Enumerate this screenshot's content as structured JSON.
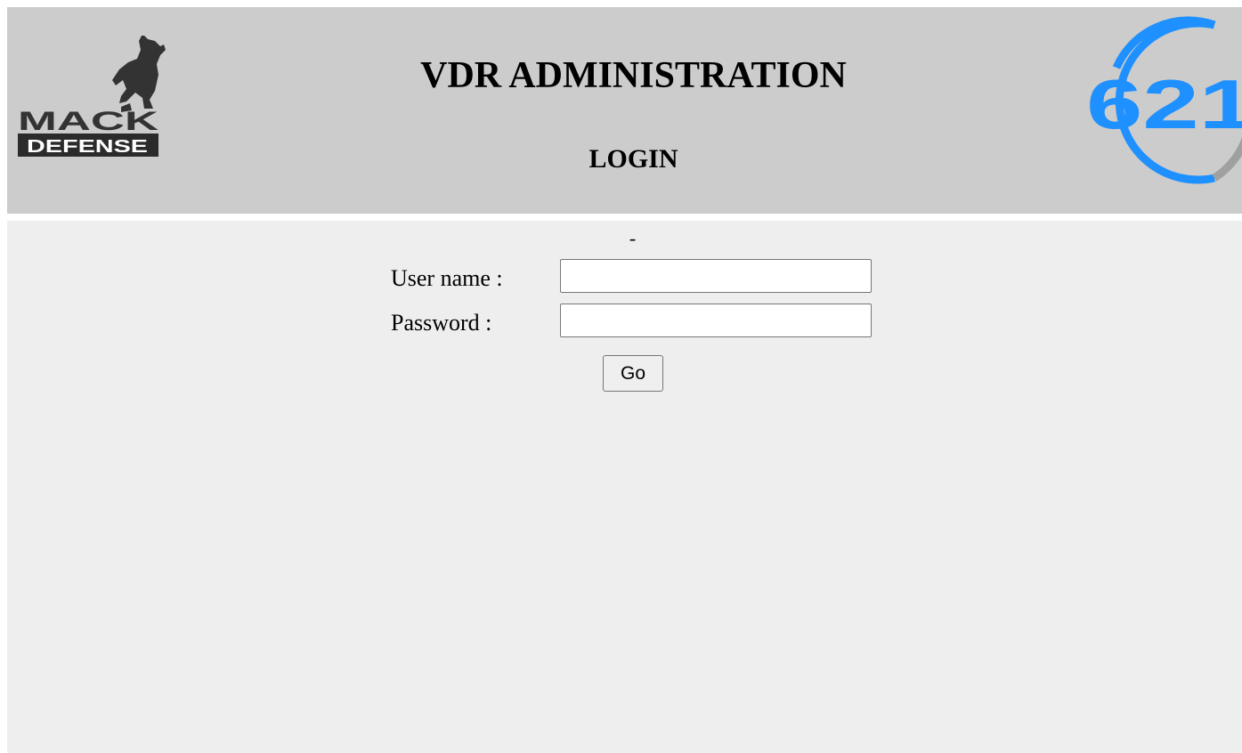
{
  "header": {
    "title": "VDR ADMINISTRATION",
    "subtitle": "LOGIN",
    "left_logo": {
      "name": "mack-defense-logo",
      "text_top": "MACK",
      "text_bottom": "DEFENSE"
    },
    "right_logo": {
      "name": "621-logo",
      "text": "621"
    }
  },
  "login": {
    "message": "-",
    "username_label": "User name :",
    "username_value": "",
    "password_label": "Password :",
    "password_value": "",
    "submit_label": "Go"
  },
  "colors": {
    "header_bg": "#cccccc",
    "body_bg": "#eeeeee",
    "logo_blue": "#1e90ff",
    "logo_gray": "#a0a0a0"
  }
}
